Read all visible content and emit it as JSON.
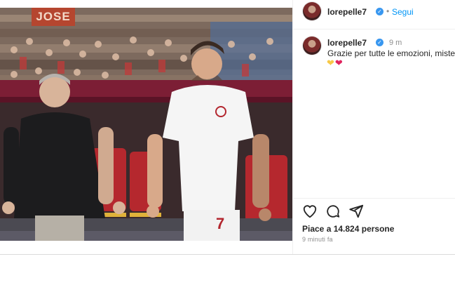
{
  "post": {
    "banner_text": "JOSE"
  },
  "header": {
    "username": "lorepelle7",
    "separator": "•",
    "follow_label": "Segui"
  },
  "comment": {
    "username": "lorepelle7",
    "time": "9 m",
    "text": "Grazie per tutte le emozioni, mister.",
    "emojis": [
      "yellow-heart",
      "red-heart"
    ]
  },
  "actions": {
    "icons": [
      "heart-icon",
      "comment-icon",
      "share-icon"
    ]
  },
  "likes": {
    "label": "Piace a 14.824 persone"
  },
  "timestamp": {
    "label": "9 minuti fa"
  },
  "colors": {
    "accent": "#0095f6",
    "verified": "#3897f0",
    "yellow_heart": "#f7c948",
    "red_heart": "#e0245e",
    "jersey_number": "#b3262e"
  }
}
